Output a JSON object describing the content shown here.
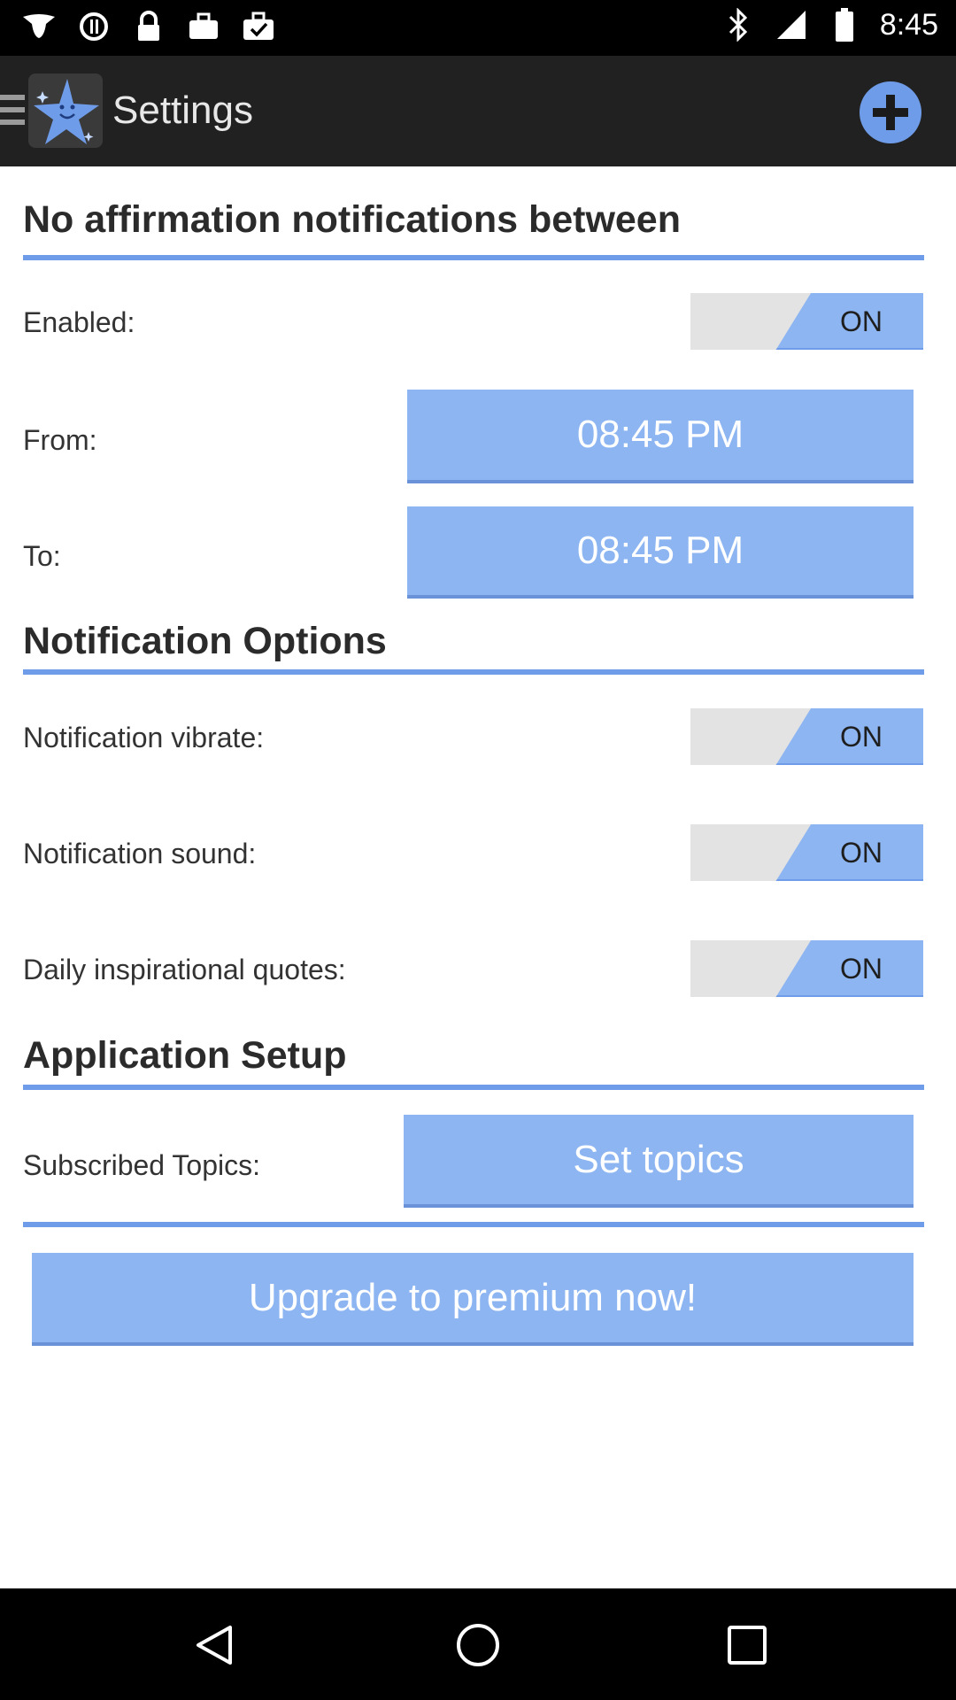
{
  "status_bar": {
    "time": "8:45",
    "icons": [
      "notification-icon",
      "sync-icon",
      "lock-icon",
      "briefcase-icon",
      "briefcase-check-icon",
      "bluetooth-icon",
      "signal-icon",
      "battery-icon"
    ]
  },
  "action_bar": {
    "title": "Settings",
    "menu_icon": "menu-icon",
    "logo_icon": "star-logo-icon",
    "add_icon": "plus-circle-icon"
  },
  "sections": {
    "quiet_hours": {
      "title": "No affirmation notifications between",
      "enabled_label": "Enabled:",
      "enabled_value": "ON",
      "from_label": "From:",
      "from_value": "08:45 PM",
      "to_label": "To:",
      "to_value": "08:45 PM"
    },
    "notification_options": {
      "title": "Notification Options",
      "vibrate_label": "Notification vibrate:",
      "vibrate_value": "ON",
      "sound_label": "Notification sound:",
      "sound_value": "ON",
      "quotes_label": "Daily inspirational quotes:",
      "quotes_value": "ON"
    },
    "application_setup": {
      "title": "Application Setup",
      "topics_label": "Subscribed Topics:",
      "topics_button": "Set topics",
      "upgrade_button": "Upgrade to premium now!"
    }
  },
  "colors": {
    "accent": "#8db5f2",
    "accent_dark": "#6f9ce8",
    "action_bar": "#212121",
    "toggle_off": "#e3e3e3"
  },
  "nav_bar": {
    "icons": [
      "back-icon",
      "home-icon",
      "recents-icon"
    ]
  }
}
